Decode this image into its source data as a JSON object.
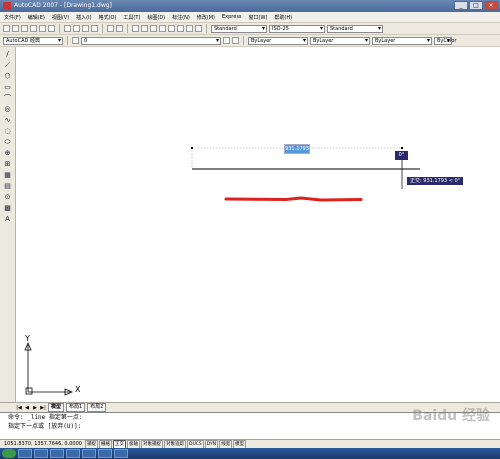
{
  "window": {
    "title": "AutoCAD 2007 - [Drawing1.dwg]",
    "buttons": [
      "_",
      "□",
      "×"
    ]
  },
  "menu": [
    "文件(F)",
    "编辑(E)",
    "视图(V)",
    "插入(I)",
    "格式(O)",
    "工具(T)",
    "绘图(D)",
    "标注(N)",
    "修改(M)",
    "Express",
    "窗口(W)",
    "帮助(H)"
  ],
  "toolbar1": {
    "text_style": "Standard",
    "dim_style": "ISO-25",
    "table_style": "Standard"
  },
  "toolbar2": {
    "workspace": "AutoCAD 经典",
    "layer": "0",
    "color": "ByLayer",
    "linetype": "ByLayer",
    "lineweight": "ByLayer",
    "plotstyle": "ByColor"
  },
  "left_tools": [
    "/",
    "⟋",
    "⬡",
    "▭",
    "⌒",
    "◎",
    "∿",
    "◌",
    "⬭",
    "⊕",
    "⊞",
    "▦",
    "▤",
    "⊙",
    "▩",
    "A"
  ],
  "canvas": {
    "dim_input": "931.1793",
    "angle_input": "0°",
    "tooltip": "正交: 931.1793 < 0°",
    "ucs_y": "Y",
    "ucs_x": "X"
  },
  "tabs": {
    "nav": [
      "|◀",
      "◀",
      "▶",
      "▶|"
    ],
    "items": [
      "模型",
      "布局1",
      "布局2"
    ]
  },
  "command": {
    "line1": "命令: _line 指定第一点:",
    "line2": "指定下一点或 [放弃(U)]:"
  },
  "status": {
    "coords": "1051.8370, 1357.7646, 0.0000",
    "buttons": [
      "捕捉",
      "栅格",
      "正交",
      "极轴",
      "对象捕捉",
      "对象追踪",
      "DUCS",
      "DYN",
      "线宽",
      "模型"
    ]
  },
  "watermark": "Baidu 经验",
  "colors": {
    "accent_red": "#dd2222",
    "selection_blue": "#5599dd",
    "tooltip_navy": "#2a2a6a"
  }
}
